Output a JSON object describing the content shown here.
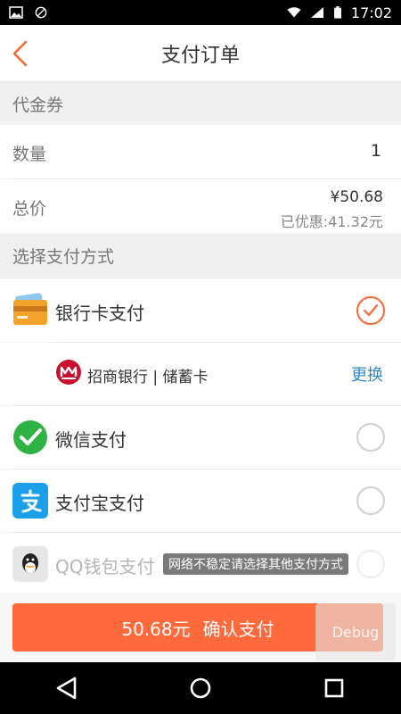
{
  "statusbar": {
    "time": "17:02"
  },
  "appbar": {
    "title": "支付订单"
  },
  "voucher": {
    "header": "代金券"
  },
  "quantity": {
    "label": "数量",
    "value": "1"
  },
  "total": {
    "label": "总价",
    "price": "¥50.68",
    "discount": "已优惠:41.32元"
  },
  "payment": {
    "header": "选择支付方式",
    "bank_card": {
      "label": "银行卡支付"
    },
    "bank": {
      "name": "招商银行 | 储蓄卡",
      "change": "更换"
    },
    "wechat": {
      "label": "微信支付"
    },
    "alipay": {
      "label": "支付宝支付"
    },
    "qq": {
      "label": "QQ钱包支付",
      "notice": "网络不稳定请选择其他支付方式"
    }
  },
  "confirm": {
    "amount": "50.68元",
    "label": "确认支付"
  },
  "debug": {
    "label": "Debug"
  },
  "colors": {
    "accent": "#ff6a3d",
    "link": "#2f86c9"
  }
}
